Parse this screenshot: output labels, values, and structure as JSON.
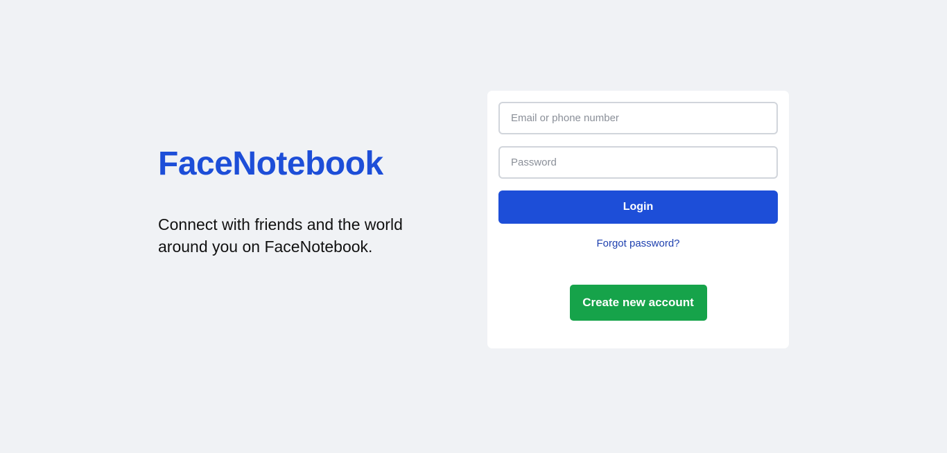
{
  "brand": {
    "title": "FaceNotebook",
    "tagline": "Connect with friends and the world around you on FaceNotebook."
  },
  "login_form": {
    "email_placeholder": "Email or phone number",
    "email_value": "",
    "password_placeholder": "Password",
    "password_value": "",
    "login_label": "Login",
    "forgot_label": "Forgot password?",
    "create_label": "Create new account"
  },
  "colors": {
    "background": "#f0f2f5",
    "brand": "#1d4ed8",
    "login_button": "#1d4ed8",
    "create_button": "#16a34a",
    "link": "#1e40af"
  }
}
